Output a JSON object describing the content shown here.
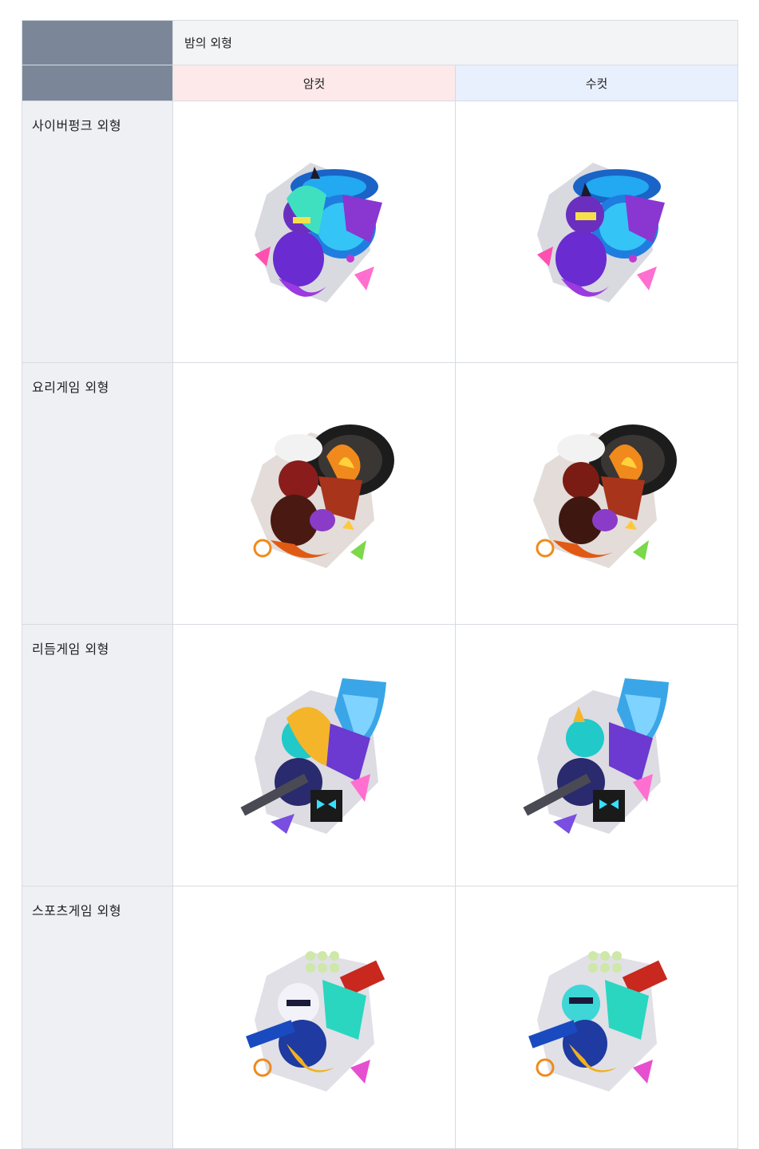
{
  "table": {
    "title": "밤의 외형",
    "female_label": "암컷",
    "male_label": "수컷",
    "rows": [
      {
        "label": "사이버펑크 외형",
        "theme": "cyberpunk",
        "female_sprite": "cyberpunk-dragon-female-sprite",
        "male_sprite": "cyberpunk-dragon-male-sprite"
      },
      {
        "label": "요리게임 외형",
        "theme": "cooking-game",
        "female_sprite": "cooking-dragon-female-sprite",
        "male_sprite": "cooking-dragon-male-sprite"
      },
      {
        "label": "리듬게임 외형",
        "theme": "rhythm-game",
        "female_sprite": "rhythm-dragon-female-sprite",
        "male_sprite": "rhythm-dragon-male-sprite"
      },
      {
        "label": "스포츠게임 외형",
        "theme": "sports-game",
        "female_sprite": "sports-dragon-female-sprite",
        "male_sprite": "sports-dragon-male-sprite"
      }
    ]
  },
  "colors": {
    "header_dark": "#7b8799",
    "header_light": "#f3f4f6",
    "female_bg": "#fde9e9",
    "male_bg": "#e8f0fd",
    "label_bg": "#eef0f3",
    "border": "#d7dbe1"
  }
}
